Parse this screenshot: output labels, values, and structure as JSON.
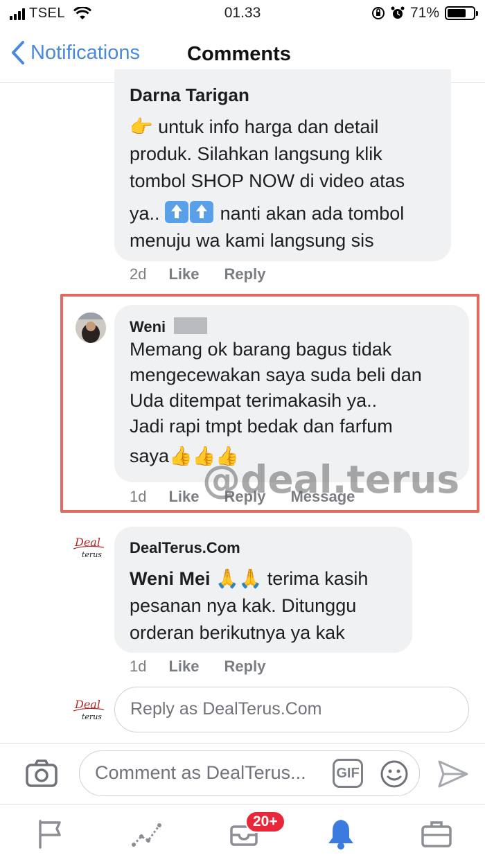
{
  "status_bar": {
    "carrier": "TSEL",
    "time": "01.33",
    "battery": "71%"
  },
  "nav": {
    "back_label": "Notifications",
    "title": "Comments"
  },
  "comments": [
    {
      "author": "Darna Tarigan",
      "lines": [
        "👉 untuk info harga dan detail",
        "produk. Silahkan langsung klik",
        "tombol SHOP NOW di video atas",
        "ya..",
        "nanti akan ada tombol",
        "menuju wa kami langsung sis"
      ],
      "time": "2d",
      "like": "Like",
      "reply": "Reply"
    },
    {
      "author": "Weni",
      "lines": [
        "Memang ok barang bagus tidak",
        "mengecewakan saya suda beli dan",
        "Uda ditempat terimakasih ya..",
        "Jadi rapi tmpt bedak dan farfum",
        "saya👍👍👍"
      ],
      "time": "1d",
      "like": "Like",
      "reply": "Reply",
      "message": "Message"
    },
    {
      "author": "DealTerus.Com",
      "mention": "Weni Mei",
      "lines": [
        "🙏🙏 terima kasih",
        "pesanan nya kak. Ditunggu",
        "orderan berikutnya ya kak"
      ],
      "time": "1d",
      "like": "Like",
      "reply": "Reply"
    }
  ],
  "reply_box": {
    "placeholder": "Reply as DealTerus.Com"
  },
  "composer": {
    "placeholder": "Comment as DealTerus...",
    "gif": "GIF"
  },
  "watermark": "@deal.terus",
  "tabbar": {
    "badge": "20+"
  },
  "colors": {
    "accent": "#4a89d8",
    "highlight": "#e06a5e",
    "badge": "#e8283a",
    "bubble": "#f0f1f3"
  },
  "logo_text": "Deal terus"
}
